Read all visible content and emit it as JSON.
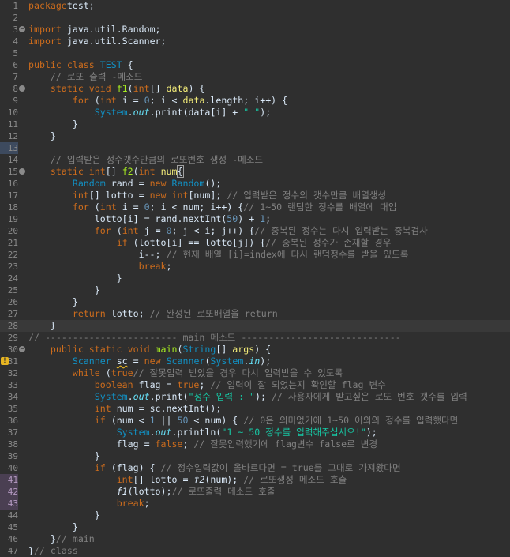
{
  "editor": {
    "gutter_icons": {
      "fold": "fold-collapse-icon",
      "warning": "warning-icon"
    },
    "lines": [
      {
        "n": "1",
        "segs": [
          [
            "kw",
            "package"
          ],
          [
            "",
            "test;"
          ]
        ]
      },
      {
        "n": "2",
        "segs": []
      },
      {
        "n": "3",
        "fold": true,
        "segs": [
          [
            "kw",
            "import"
          ],
          [
            "",
            " java.util.Random;"
          ]
        ]
      },
      {
        "n": "4",
        "segs": [
          [
            "kw",
            "import"
          ],
          [
            "",
            " java.util.Scanner;"
          ]
        ]
      },
      {
        "n": "5",
        "segs": []
      },
      {
        "n": "6",
        "segs": [
          [
            "kw",
            "public class"
          ],
          [
            "",
            " "
          ],
          [
            "ty",
            "TEST"
          ],
          [
            "",
            " {"
          ]
        ]
      },
      {
        "n": "7",
        "segs": [
          [
            "",
            "    "
          ],
          [
            "cm",
            "// 로또 출력 -메소드"
          ]
        ]
      },
      {
        "n": "8",
        "fold": true,
        "segs": [
          [
            "",
            "    "
          ],
          [
            "kw",
            "static void"
          ],
          [
            "",
            " "
          ],
          [
            "fn",
            "f1"
          ],
          [
            "",
            "("
          ],
          [
            "kw",
            "int"
          ],
          [
            "",
            "[] "
          ],
          [
            "var",
            "data"
          ],
          [
            "",
            ") {"
          ]
        ]
      },
      {
        "n": "9",
        "segs": [
          [
            "",
            "        "
          ],
          [
            "kw",
            "for"
          ],
          [
            "",
            " ("
          ],
          [
            "kw",
            "int"
          ],
          [
            "",
            " i = "
          ],
          [
            "nm",
            "0"
          ],
          [
            "",
            "; i < "
          ],
          [
            "var",
            "data"
          ],
          [
            "",
            ".length; i++) {"
          ]
        ]
      },
      {
        "n": "10",
        "segs": [
          [
            "",
            "            "
          ],
          [
            "ty",
            "System"
          ],
          [
            "",
            "."
          ],
          [
            "fld",
            "out"
          ],
          [
            "",
            ".print(data[i] + "
          ],
          [
            "st",
            "\" \""
          ],
          [
            "",
            ");"
          ]
        ]
      },
      {
        "n": "11",
        "segs": [
          [
            "",
            "        }"
          ]
        ]
      },
      {
        "n": "12",
        "segs": [
          [
            "",
            "    }"
          ]
        ]
      },
      {
        "n": "13",
        "sel": true,
        "segs": []
      },
      {
        "n": "14",
        "segs": [
          [
            "",
            "    "
          ],
          [
            "cm",
            "// 입력받은 정수갯수만큼의 로또번호 생성 -메소드"
          ]
        ]
      },
      {
        "n": "15",
        "fold": true,
        "segs": [
          [
            "",
            "    "
          ],
          [
            "kw",
            "static int"
          ],
          [
            "",
            "[] "
          ],
          [
            "fn",
            "f2"
          ],
          [
            "",
            "("
          ],
          [
            "kw",
            "int"
          ],
          [
            "",
            " "
          ],
          [
            "var",
            "num"
          ],
          [
            ") "
          ],
          [
            "bracket",
            "{"
          ]
        ]
      },
      {
        "n": "16",
        "segs": [
          [
            "",
            "        "
          ],
          [
            "ty",
            "Random"
          ],
          [
            "",
            " rand = "
          ],
          [
            "kw",
            "new"
          ],
          [
            "",
            " "
          ],
          [
            "ty",
            "Random"
          ],
          [
            "",
            "();"
          ]
        ]
      },
      {
        "n": "17",
        "segs": [
          [
            "",
            "        "
          ],
          [
            "kw",
            "int"
          ],
          [
            "",
            "[] lotto = "
          ],
          [
            "kw",
            "new int"
          ],
          [
            "",
            "[num]; "
          ],
          [
            "cm",
            "// 입력받은 정수의 갯수만큼 배열생성"
          ]
        ]
      },
      {
        "n": "18",
        "segs": [
          [
            "",
            "        "
          ],
          [
            "kw",
            "for"
          ],
          [
            "",
            " ("
          ],
          [
            "kw",
            "int"
          ],
          [
            "",
            " i = "
          ],
          [
            "nm",
            "0"
          ],
          [
            "",
            "; i < num; i++) {"
          ],
          [
            "cm",
            "// 1~50 랜덤한 정수를 배열에 대입"
          ]
        ]
      },
      {
        "n": "19",
        "segs": [
          [
            "",
            "            lotto[i] = rand.nextInt("
          ],
          [
            "nm",
            "50"
          ],
          [
            "",
            ") + "
          ],
          [
            "nm",
            "1"
          ],
          [
            "",
            ";"
          ]
        ]
      },
      {
        "n": "20",
        "segs": [
          [
            "",
            "            "
          ],
          [
            "kw",
            "for"
          ],
          [
            "",
            " ("
          ],
          [
            "kw",
            "int"
          ],
          [
            "",
            " j = "
          ],
          [
            "nm",
            "0"
          ],
          [
            "",
            "; j < i; j++) {"
          ],
          [
            "cm",
            "// 중복된 정수는 다시 입력받는 중복검사"
          ]
        ]
      },
      {
        "n": "21",
        "segs": [
          [
            "",
            "                "
          ],
          [
            "kw",
            "if"
          ],
          [
            "",
            " (lotto[i] == lotto[j]) {"
          ],
          [
            "cm",
            "// 중복된 정수가 존재할 경우"
          ]
        ]
      },
      {
        "n": "22",
        "segs": [
          [
            "",
            "                    i--; "
          ],
          [
            "cm",
            "// 현재 배열 [i]=index에 다시 랜덤정수를 받을 있도록"
          ]
        ]
      },
      {
        "n": "23",
        "segs": [
          [
            "",
            "                    "
          ],
          [
            "kw",
            "break"
          ],
          [
            "",
            ";"
          ]
        ]
      },
      {
        "n": "24",
        "segs": [
          [
            "",
            "                }"
          ]
        ]
      },
      {
        "n": "25",
        "segs": [
          [
            "",
            "            }"
          ]
        ]
      },
      {
        "n": "26",
        "segs": [
          [
            "",
            "        }"
          ]
        ]
      },
      {
        "n": "27",
        "segs": [
          [
            "",
            "        "
          ],
          [
            "kw",
            "return"
          ],
          [
            "",
            " lotto; "
          ],
          [
            "cm",
            "// 완성된 로또배열을 return"
          ]
        ]
      },
      {
        "n": "28",
        "hl": true,
        "segs": [
          [
            "",
            "    }"
          ]
        ]
      },
      {
        "n": "29",
        "segs": [
          [
            "cm",
            "// ------------------------ main 메소드 -----------------------------"
          ]
        ]
      },
      {
        "n": "30",
        "fold": true,
        "segs": [
          [
            "",
            "    "
          ],
          [
            "kw",
            "public static void"
          ],
          [
            "",
            " "
          ],
          [
            "fn",
            "main"
          ],
          [
            "",
            "("
          ],
          [
            "ty",
            "String"
          ],
          [
            "",
            "[] "
          ],
          [
            "var",
            "args"
          ],
          [
            "",
            ") {"
          ]
        ]
      },
      {
        "n": "31",
        "warn": true,
        "segs": [
          [
            "",
            "        "
          ],
          [
            "ty",
            "Scanner"
          ],
          [
            "",
            " "
          ],
          [
            "warn-under",
            "sc"
          ],
          [
            "",
            " = "
          ],
          [
            "kw",
            "new"
          ],
          [
            "",
            " "
          ],
          [
            "ty",
            "Scanner"
          ],
          [
            "",
            "("
          ],
          [
            "ty",
            "System"
          ],
          [
            "",
            "."
          ],
          [
            "fld",
            "in"
          ],
          [
            "",
            ");"
          ]
        ]
      },
      {
        "n": "32",
        "segs": [
          [
            "",
            "        "
          ],
          [
            "kw",
            "while"
          ],
          [
            "",
            " ("
          ],
          [
            "kw",
            "true"
          ],
          [
            ") { "
          ],
          [
            "cm",
            "// 잘못입력 받았을 경우 다시 입력받을 수 있도록"
          ]
        ]
      },
      {
        "n": "33",
        "segs": [
          [
            "",
            "            "
          ],
          [
            "kw",
            "boolean"
          ],
          [
            "",
            " flag = "
          ],
          [
            "kw",
            "true"
          ],
          [
            "",
            "; "
          ],
          [
            "cm",
            "// 입력이 잘 되었는지 확인할 flag 변수"
          ]
        ]
      },
      {
        "n": "34",
        "segs": [
          [
            "",
            "            "
          ],
          [
            "ty",
            "System"
          ],
          [
            "",
            "."
          ],
          [
            "fld",
            "out"
          ],
          [
            "",
            ".print("
          ],
          [
            "st",
            "\"정수 입력 : \""
          ],
          [
            "",
            "); "
          ],
          [
            "cm",
            "// 사용자에게 받고싶은 로또 번호 갯수를 입력"
          ]
        ]
      },
      {
        "n": "35",
        "segs": [
          [
            "",
            "            "
          ],
          [
            "kw",
            "int"
          ],
          [
            "",
            " num = sc.nextInt();"
          ]
        ]
      },
      {
        "n": "36",
        "segs": [
          [
            "",
            "            "
          ],
          [
            "kw",
            "if"
          ],
          [
            "",
            " (num < "
          ],
          [
            "nm",
            "1"
          ],
          [
            "",
            " || "
          ],
          [
            "nm",
            "50"
          ],
          [
            "",
            " < num) { "
          ],
          [
            "cm",
            "// 0은 의미없기에 1~50 이외의 정수를 입력했다면"
          ]
        ]
      },
      {
        "n": "37",
        "segs": [
          [
            "",
            "                "
          ],
          [
            "ty",
            "System"
          ],
          [
            "",
            "."
          ],
          [
            "fld",
            "out"
          ],
          [
            "",
            ".println("
          ],
          [
            "st",
            "\"1 ~ 50 정수를 입력해주십시오!\""
          ],
          [
            "",
            ");"
          ]
        ]
      },
      {
        "n": "38",
        "segs": [
          [
            "",
            "                flag = "
          ],
          [
            "kw",
            "false"
          ],
          [
            "",
            "; "
          ],
          [
            "cm",
            "// 잘못입력했기에 flag변수 false로 변경"
          ]
        ]
      },
      {
        "n": "39",
        "segs": [
          [
            "",
            "            }"
          ]
        ]
      },
      {
        "n": "40",
        "segs": [
          [
            "",
            "            "
          ],
          [
            "kw",
            "if"
          ],
          [
            "",
            " (flag) { "
          ],
          [
            "cm",
            "// 정수입력값이 올바르다면 = true를 그대로 가져왔다면"
          ]
        ]
      },
      {
        "n": "41",
        "q": true,
        "segs": [
          [
            "",
            "                "
          ],
          [
            "kw",
            "int"
          ],
          [
            "",
            "[] lotto = "
          ],
          [
            "ital",
            "f2"
          ],
          [
            "",
            "(num); "
          ],
          [
            "cm",
            "// 로또생성 메소드 호출"
          ]
        ]
      },
      {
        "n": "42",
        "q": true,
        "segs": [
          [
            "",
            "                "
          ],
          [
            "ital",
            "f1"
          ],
          [
            "",
            "(lotto);"
          ],
          [
            "cm",
            "// 로또출력 메소드 호출"
          ]
        ]
      },
      {
        "n": "43",
        "q": true,
        "segs": [
          [
            "",
            "                "
          ],
          [
            "kw",
            "break"
          ],
          [
            "",
            ";"
          ]
        ]
      },
      {
        "n": "44",
        "segs": [
          [
            "",
            "            }"
          ]
        ]
      },
      {
        "n": "45",
        "segs": [
          [
            "",
            "        }"
          ]
        ]
      },
      {
        "n": "46",
        "segs": [
          [
            "",
            "    }"
          ],
          [
            "cm",
            "// main"
          ]
        ]
      },
      {
        "n": "47",
        "segs": [
          [
            "",
            "}"
          ],
          [
            "cm",
            "// class"
          ]
        ]
      }
    ]
  }
}
